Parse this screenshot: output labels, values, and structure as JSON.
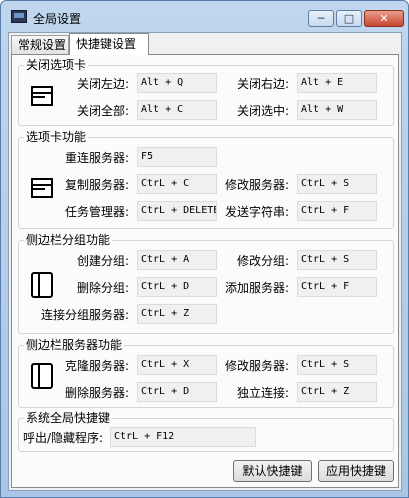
{
  "window": {
    "title": "全局设置",
    "minimize": "─",
    "maximize": "□",
    "close": "✕"
  },
  "tabs": [
    "常规设置",
    "快捷键设置"
  ],
  "groups": {
    "close_tabs": {
      "title": "关闭选项卡",
      "rows": [
        {
          "label": "关闭左边:",
          "value": "Alt + Q"
        },
        {
          "label": "关闭右边:",
          "value": "Alt + E"
        },
        {
          "label": "关闭全部:",
          "value": "Alt + C"
        },
        {
          "label": "关闭选中:",
          "value": "Alt + W"
        }
      ]
    },
    "tab_functions": {
      "title": "选项卡功能",
      "rows": [
        {
          "label": "重连服务器:",
          "value": "F5"
        },
        {
          "label": "复制服务器:",
          "value": "CtrL + C"
        },
        {
          "label": "修改服务器:",
          "value": "CtrL + S"
        },
        {
          "label": "任务管理器:",
          "value": "CtrL + DELETE"
        },
        {
          "label": "发送字符串:",
          "value": "CtrL + F"
        }
      ]
    },
    "sidebar_group": {
      "title": "侧边栏分组功能",
      "rows": [
        {
          "label": "创建分组:",
          "value": "CtrL + A"
        },
        {
          "label": "修改分组:",
          "value": "CtrL + S"
        },
        {
          "label": "删除分组:",
          "value": "CtrL + D"
        },
        {
          "label": "添加服务器:",
          "value": "CtrL + F"
        },
        {
          "label": "连接分组服务器:",
          "value": "CtrL + Z"
        }
      ]
    },
    "sidebar_server": {
      "title": "侧边栏服务器功能",
      "rows": [
        {
          "label": "克隆服务器:",
          "value": "CtrL + X"
        },
        {
          "label": "修改服务器:",
          "value": "CtrL + S"
        },
        {
          "label": "删除服务器:",
          "value": "CtrL + D"
        },
        {
          "label": "独立连接:",
          "value": "CtrL + Z"
        }
      ]
    },
    "global": {
      "title": "系统全局快捷键",
      "rows": [
        {
          "label": "呼出/隐藏程序:",
          "value": "CtrL + F12"
        }
      ]
    }
  },
  "buttons": {
    "default": "默认快捷键",
    "apply": "应用快捷键"
  }
}
